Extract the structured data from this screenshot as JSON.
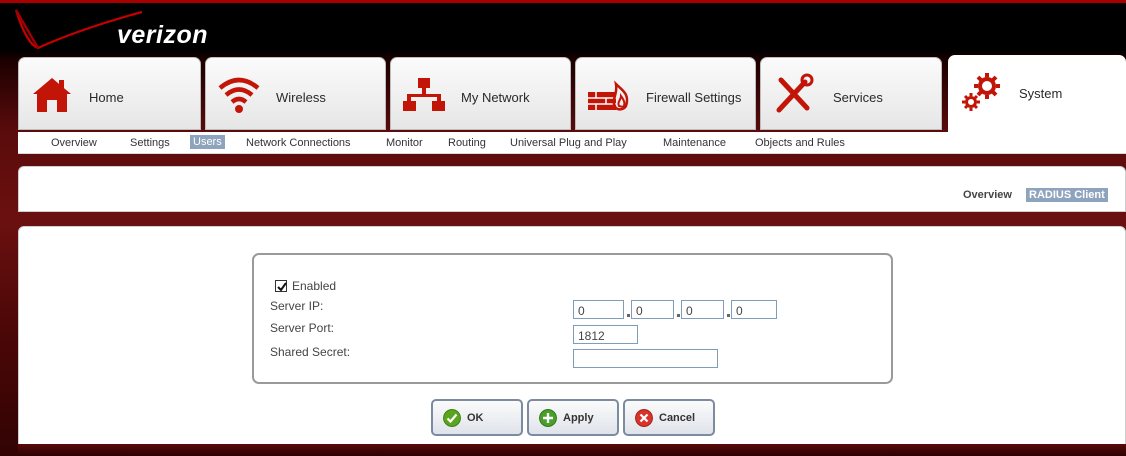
{
  "brand": {
    "logo_text": "verizon"
  },
  "nav": {
    "tabs": [
      {
        "label": "Home"
      },
      {
        "label": "Wireless"
      },
      {
        "label": "My Network"
      },
      {
        "label": "Firewall Settings"
      },
      {
        "label": "Services"
      },
      {
        "label": "System"
      }
    ],
    "active_tab": "System"
  },
  "subnav": {
    "items": [
      "Overview",
      "Settings",
      "Users",
      "Network Connections",
      "Monitor",
      "Routing",
      "Universal Plug and Play",
      "Maintenance",
      "Objects and Rules"
    ],
    "active": "Users"
  },
  "section_nav": {
    "items": [
      "Overview",
      "RADIUS Client"
    ],
    "active": "RADIUS Client"
  },
  "form": {
    "enabled_label": "Enabled",
    "enabled_checked": true,
    "server_ip_label": "Server IP:",
    "server_ip_octets": [
      "0",
      "0",
      "0",
      "0"
    ],
    "server_port_label": "Server Port:",
    "server_port_value": "1812",
    "shared_secret_label": "Shared Secret:",
    "shared_secret_value": ""
  },
  "buttons": {
    "ok": "OK",
    "apply": "Apply",
    "cancel": "Cancel"
  },
  "colors": {
    "accent_red": "#c40000",
    "selection_blue": "#8ea3bd",
    "ok_green": "#5aa51f",
    "apply_green": "#48a02a",
    "cancel_red": "#d7342c"
  },
  "icons": [
    "home-icon",
    "wireless-icon",
    "network-icon",
    "firewall-icon",
    "services-icon",
    "system-icon",
    "check-icon",
    "plus-icon",
    "close-icon"
  ]
}
